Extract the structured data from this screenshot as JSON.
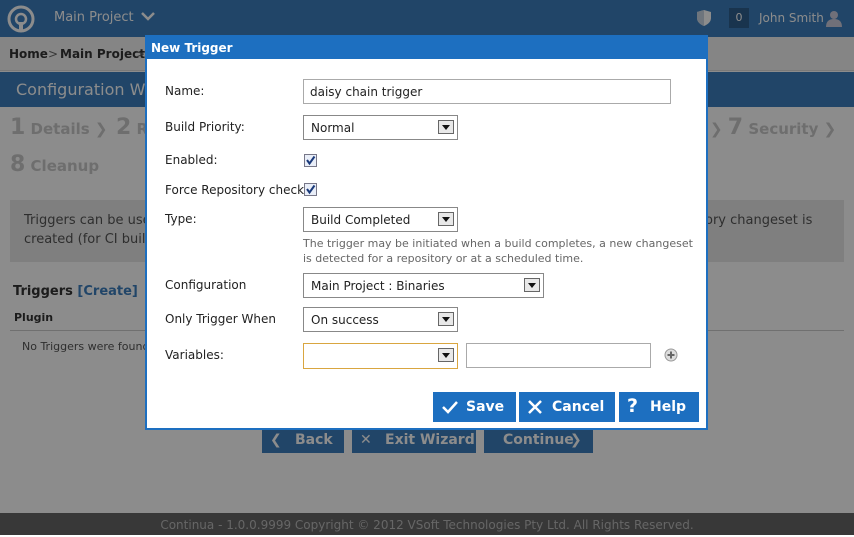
{
  "topbar": {
    "project_name": "Main Project",
    "badge_count": "0",
    "user_name": "John Smith"
  },
  "breadcrumb": {
    "home": "Home",
    "sep": ">",
    "project": "Main Project",
    "current": ">"
  },
  "wizard": {
    "title": "Configuration Wizard",
    "steps": [
      {
        "num": "1",
        "label": "Details"
      },
      {
        "num": "2",
        "label": "R"
      },
      {
        "num": "7",
        "label": "Security"
      },
      {
        "num": "8",
        "label": "Cleanup"
      }
    ],
    "info_left_1": "Triggers can be used",
    "info_left_2": "created (for CI build",
    "info_right": "ory changeset is",
    "triggers_title": "Triggers",
    "triggers_create": "[Create]",
    "col_plugin": "Plugin",
    "no_triggers": "No Triggers were found",
    "back_label": "Back",
    "exit_label": "Exit Wizard",
    "continue_label": "Continue"
  },
  "dialog": {
    "title": "New Trigger",
    "name_label": "Name:",
    "name_value": "daisy chain trigger",
    "priority_label": "Build Priority:",
    "priority_value": "Normal",
    "enabled_label": "Enabled:",
    "enabled_checked": true,
    "force_label": "Force Repository check:",
    "force_checked": true,
    "type_label": "Type:",
    "type_value": "Build Completed",
    "type_help": "The trigger may be initiated when a build completes, a new changeset is detected for a repository or at a scheduled time.",
    "config_label": "Configuration",
    "config_value": "Main Project : Binaries",
    "only_when_label": "Only Trigger When",
    "only_when_value": "On success",
    "variables_label": "Variables:",
    "variables_select_value": "",
    "variables_text_value": "",
    "save_label": "Save",
    "cancel_label": "Cancel",
    "help_label": "Help"
  },
  "footer": {
    "text": "Continua - 1.0.0.9999 Copyright © 2012 VSoft Technologies Pty Ltd. All Rights Reserved."
  },
  "colors": {
    "brand_blue": "#3d7fbd",
    "dialog_blue": "#1d6fc0",
    "footer_gray": "#666666"
  }
}
